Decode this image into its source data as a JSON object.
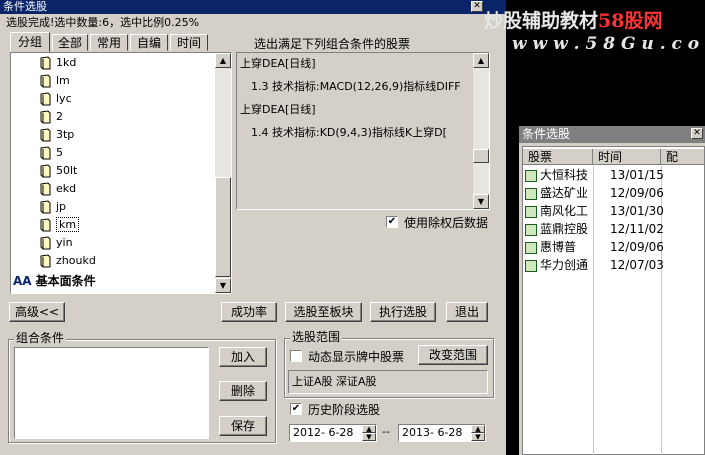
{
  "main_window": {
    "title": "条件选股",
    "status": "选股完成!选中数量:6，选中比例0.25%",
    "tabs": [
      "分组",
      "全部",
      "常用",
      "自编",
      "时间"
    ],
    "tree_items": [
      "1kd",
      "lm",
      "lyc",
      "2",
      "3tp",
      "5",
      "50lt",
      "ekd",
      "jp",
      "km",
      "yin",
      "zhoukd"
    ],
    "tree_selected": "km",
    "tree_footer": "基本面条件",
    "right_header": "选出满足下列组合条件的股票",
    "conditions": [
      "上穿DEA[日线]",
      "1.3 技术指标:MACD(12,26,9)指标线DIFF",
      "上穿DEA[日线]",
      "1.4 技术指标:KD(9,4,3)指标线K上穿D["
    ],
    "use_adjusted_label": "使用除权后数据",
    "use_adjusted_checked": true,
    "buttons": {
      "advanced": "高级<<",
      "success_rate": "成功率",
      "to_block": "选股至板块",
      "execute": "执行选股",
      "exit": "退出",
      "add": "加入",
      "delete": "删除",
      "save": "保存",
      "change_range": "改变范围"
    },
    "combo_group_label": "组合条件",
    "range_group_label": "选股范围",
    "dynamic_label": "动态显示牌中股票",
    "dynamic_checked": false,
    "range_text": "上证A股 深证A股",
    "history_label": "历史阶段选股",
    "history_checked": true,
    "date_from": "2012- 6-28",
    "date_sep": "--",
    "date_to": "2013- 6-28"
  },
  "watermark": {
    "line1_a": "炒股辅助教材",
    "line1_b": "58股网",
    "line2": "w w w . 5 8 G u . c o m"
  },
  "result_window": {
    "title": "条件选股",
    "columns": [
      "股票",
      "时间",
      "配"
    ],
    "rows": [
      {
        "name": "大恒科技",
        "date": "13/01/15"
      },
      {
        "name": "盛达矿业",
        "date": "12/09/06"
      },
      {
        "name": "南风化工",
        "date": "13/01/30"
      },
      {
        "name": "蓝鼎控股",
        "date": "12/11/02"
      },
      {
        "name": "惠博普",
        "date": "12/09/06"
      },
      {
        "name": "华力创通",
        "date": "12/07/03"
      }
    ]
  },
  "colors": {
    "title_active": "#0a246a",
    "window_bg": "#d4d0c8",
    "watermark_text": "#e8e8e8",
    "watermark_accent": "#ff3333"
  }
}
